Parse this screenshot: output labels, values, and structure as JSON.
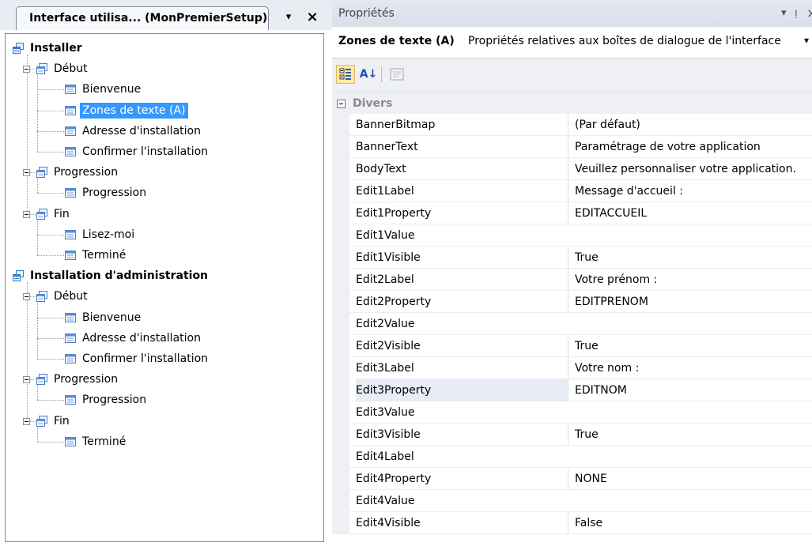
{
  "left_panel": {
    "tab_title": "Interface utilisa... (MonPremierSetup)",
    "dropdown_glyph": "▾",
    "close_glyph": "×",
    "tree": [
      {
        "label": "Installer",
        "level": 0,
        "kind": "root",
        "icon": "dialog-stack-icon"
      },
      {
        "label": "Début",
        "level": 1,
        "kind": "group",
        "icon": "folder-dialog-icon"
      },
      {
        "label": "Bienvenue",
        "level": 2,
        "kind": "dialog",
        "icon": "dialog-icon"
      },
      {
        "label": "Zones de texte  (A)",
        "level": 2,
        "kind": "dialog",
        "icon": "dialog-icon",
        "selected": true
      },
      {
        "label": "Adresse d'installation",
        "level": 2,
        "kind": "dialog",
        "icon": "dialog-icon"
      },
      {
        "label": "Confirmer l'installation",
        "level": 2,
        "kind": "dialog",
        "icon": "dialog-icon",
        "last": true
      },
      {
        "label": "Progression",
        "level": 1,
        "kind": "group",
        "icon": "folder-dialog-icon"
      },
      {
        "label": "Progression",
        "level": 2,
        "kind": "dialog",
        "icon": "dialog-icon",
        "last": true
      },
      {
        "label": "Fin",
        "level": 1,
        "kind": "group",
        "icon": "folder-dialog-icon",
        "last": true
      },
      {
        "label": "Lisez-moi",
        "level": 2,
        "kind": "dialog",
        "icon": "dialog-icon"
      },
      {
        "label": "Terminé",
        "level": 2,
        "kind": "dialog",
        "icon": "dialog-icon",
        "last": true
      },
      {
        "label": "Installation d'administration",
        "level": 0,
        "kind": "root",
        "icon": "dialog-stack-icon"
      },
      {
        "label": "Début",
        "level": 1,
        "kind": "group",
        "icon": "folder-dialog-icon"
      },
      {
        "label": "Bienvenue",
        "level": 2,
        "kind": "dialog",
        "icon": "dialog-icon"
      },
      {
        "label": "Adresse d'installation",
        "level": 2,
        "kind": "dialog",
        "icon": "dialog-icon"
      },
      {
        "label": "Confirmer l'installation",
        "level": 2,
        "kind": "dialog",
        "icon": "dialog-icon",
        "last": true
      },
      {
        "label": "Progression",
        "level": 1,
        "kind": "group",
        "icon": "folder-dialog-icon"
      },
      {
        "label": "Progression",
        "level": 2,
        "kind": "dialog",
        "icon": "dialog-icon",
        "last": true
      },
      {
        "label": "Fin",
        "level": 1,
        "kind": "group",
        "icon": "folder-dialog-icon",
        "last": true
      },
      {
        "label": "Terminé",
        "level": 2,
        "kind": "dialog",
        "icon": "dialog-icon",
        "last": true
      }
    ]
  },
  "properties": {
    "title": "Propriétés",
    "header_buttons": {
      "dropdown": "▾",
      "pin": "ᴉ",
      "close": "×"
    },
    "object_name": "Zones de texte  (A)",
    "object_description": "Propriétés relatives aux boîtes de dialogue de l'interface",
    "object_dropdown": "▾",
    "toolbar": {
      "alphabetical_label": "A↓"
    },
    "category": "Divers",
    "rows": [
      {
        "name": "BannerBitmap",
        "value": "(Par défaut)"
      },
      {
        "name": "BannerText",
        "value": "Paramétrage de votre application"
      },
      {
        "name": "BodyText",
        "value": "Veuillez personnaliser votre application."
      },
      {
        "name": "Edit1Label",
        "value": "Message d'accueil :"
      },
      {
        "name": "Edit1Property",
        "value": "EDITACCUEIL"
      },
      {
        "name": "Edit1Value",
        "value": ""
      },
      {
        "name": "Edit1Visible",
        "value": "True"
      },
      {
        "name": "Edit2Label",
        "value": "Votre prénom :"
      },
      {
        "name": "Edit2Property",
        "value": "EDITPRENOM"
      },
      {
        "name": "Edit2Value",
        "value": ""
      },
      {
        "name": "Edit2Visible",
        "value": "True"
      },
      {
        "name": "Edit3Label",
        "value": "Votre nom :"
      },
      {
        "name": "Edit3Property",
        "value": "EDITNOM",
        "highlight": true
      },
      {
        "name": "Edit3Value",
        "value": ""
      },
      {
        "name": "Edit3Visible",
        "value": "True"
      },
      {
        "name": "Edit4Label",
        "value": ""
      },
      {
        "name": "Edit4Property",
        "value": "NONE"
      },
      {
        "name": "Edit4Value",
        "value": ""
      },
      {
        "name": "Edit4Visible",
        "value": "False"
      }
    ]
  },
  "colors": {
    "selection": "#3399ff",
    "panel_background": "#e9ecf2",
    "category_text": "#888888"
  }
}
